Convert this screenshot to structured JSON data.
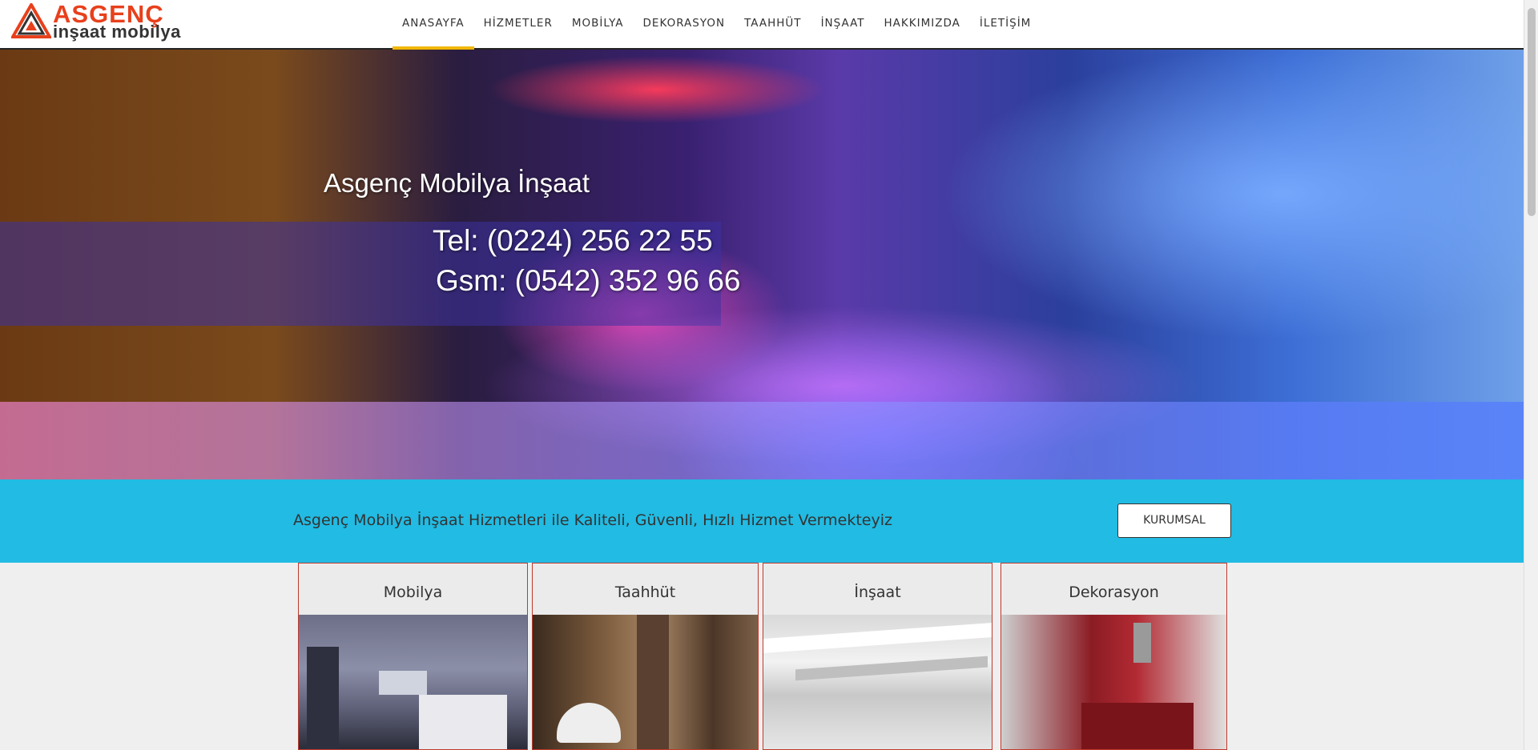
{
  "logo": {
    "line1": "ASGENÇ",
    "line2": "inşaat mobilya",
    "colors": {
      "primary": "#e8401c",
      "secondary": "#333333"
    }
  },
  "nav": {
    "items": [
      {
        "label": "ANASAYFA"
      },
      {
        "label": "HİZMETLER"
      },
      {
        "label": "MOBİLYA"
      },
      {
        "label": "DEKORASYON"
      },
      {
        "label": "TAAHHÜT"
      },
      {
        "label": "İNŞAAT"
      },
      {
        "label": "HAKKIMIZDA"
      },
      {
        "label": "İLETİŞİM"
      }
    ],
    "active_color": "#f2b705"
  },
  "hero": {
    "title": "Asgenç Mobilya İnşaat",
    "tel": "Tel: (0224) 256 22 55",
    "gsm": "Gsm: (0542) 352 96 66"
  },
  "strip": {
    "text": "Asgenç Mobilya İnşaat Hizmetleri ile Kaliteli, Güvenli, Hızlı  Hizmet Vermekteyiz",
    "button_label": "KURUMSAL",
    "color": "#21bbe3"
  },
  "cards": [
    {
      "title": "Mobilya"
    },
    {
      "title": "Taahhüt"
    },
    {
      "title": "İnşaat"
    },
    {
      "title": "Dekorasyon"
    }
  ]
}
